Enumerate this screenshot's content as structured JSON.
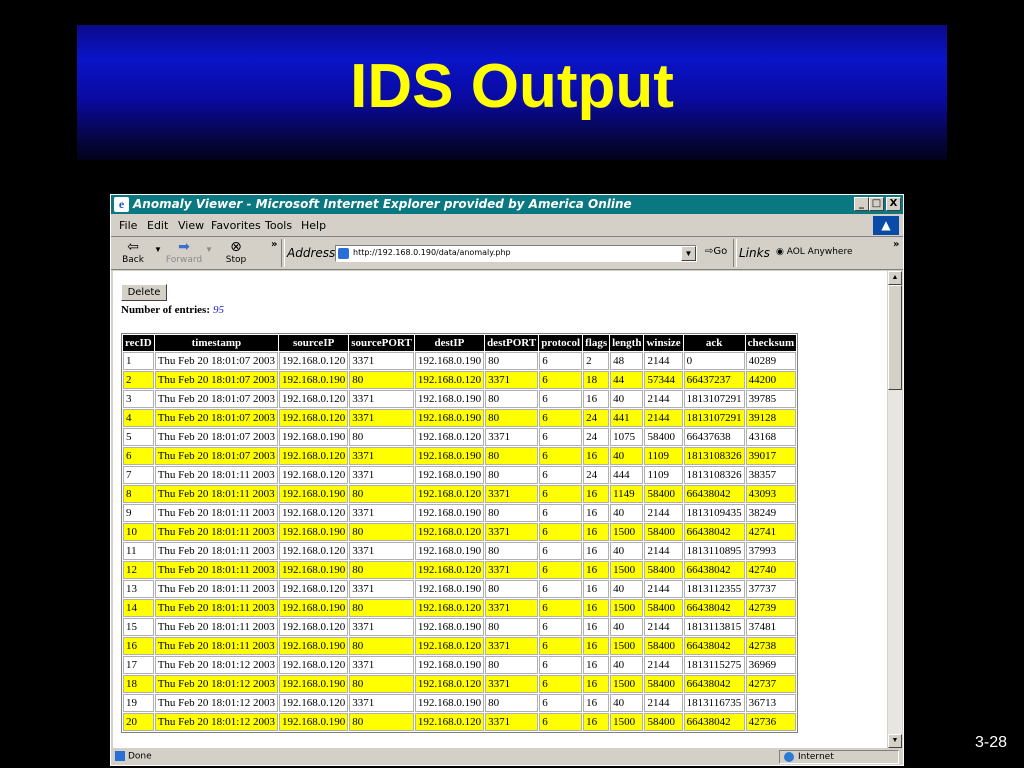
{
  "slide": {
    "title": "IDS Output",
    "number": "3-28"
  },
  "window": {
    "title": "Anomaly Viewer - Microsoft Internet Explorer provided by America Online",
    "controls": [
      "_",
      "□",
      "X"
    ]
  },
  "menu": {
    "items": [
      "File",
      "Edit",
      "View",
      "Favorites",
      "Tools",
      "Help"
    ]
  },
  "toolbar": {
    "back": "Back",
    "forward": "Forward",
    "stop": "Stop",
    "more": "»",
    "address_label": "Address",
    "url": "http://192.168.0.190/data/anomaly.php",
    "go": "Go",
    "links_label": "Links",
    "links_item": "AOL Anywhere",
    "links_more": "»"
  },
  "page": {
    "delete_label": "Delete",
    "entries_label": "Number of entries:",
    "entries_count": "95"
  },
  "table": {
    "headers": [
      "recID",
      "timestamp",
      "sourceIP",
      "sourcePORT",
      "destIP",
      "destPORT",
      "protocol",
      "flags",
      "length",
      "winsize",
      "ack",
      "checksum"
    ],
    "rows": [
      [
        "1",
        "Thu Feb 20 18:01:07 2003",
        "192.168.0.120",
        "3371",
        "192.168.0.190",
        "80",
        "6",
        "2",
        "48",
        "2144",
        "0",
        "40289"
      ],
      [
        "2",
        "Thu Feb 20 18:01:07 2003",
        "192.168.0.190",
        "80",
        "192.168.0.120",
        "3371",
        "6",
        "18",
        "44",
        "57344",
        "66437237",
        "44200"
      ],
      [
        "3",
        "Thu Feb 20 18:01:07 2003",
        "192.168.0.120",
        "3371",
        "192.168.0.190",
        "80",
        "6",
        "16",
        "40",
        "2144",
        "1813107291",
        "39785"
      ],
      [
        "4",
        "Thu Feb 20 18:01:07 2003",
        "192.168.0.120",
        "3371",
        "192.168.0.190",
        "80",
        "6",
        "24",
        "441",
        "2144",
        "1813107291",
        "39128"
      ],
      [
        "5",
        "Thu Feb 20 18:01:07 2003",
        "192.168.0.190",
        "80",
        "192.168.0.120",
        "3371",
        "6",
        "24",
        "1075",
        "58400",
        "66437638",
        "43168"
      ],
      [
        "6",
        "Thu Feb 20 18:01:07 2003",
        "192.168.0.120",
        "3371",
        "192.168.0.190",
        "80",
        "6",
        "16",
        "40",
        "1109",
        "1813108326",
        "39017"
      ],
      [
        "7",
        "Thu Feb 20 18:01:11 2003",
        "192.168.0.120",
        "3371",
        "192.168.0.190",
        "80",
        "6",
        "24",
        "444",
        "1109",
        "1813108326",
        "38357"
      ],
      [
        "8",
        "Thu Feb 20 18:01:11 2003",
        "192.168.0.190",
        "80",
        "192.168.0.120",
        "3371",
        "6",
        "16",
        "1149",
        "58400",
        "66438042",
        "43093"
      ],
      [
        "9",
        "Thu Feb 20 18:01:11 2003",
        "192.168.0.120",
        "3371",
        "192.168.0.190",
        "80",
        "6",
        "16",
        "40",
        "2144",
        "1813109435",
        "38249"
      ],
      [
        "10",
        "Thu Feb 20 18:01:11 2003",
        "192.168.0.190",
        "80",
        "192.168.0.120",
        "3371",
        "6",
        "16",
        "1500",
        "58400",
        "66438042",
        "42741"
      ],
      [
        "11",
        "Thu Feb 20 18:01:11 2003",
        "192.168.0.120",
        "3371",
        "192.168.0.190",
        "80",
        "6",
        "16",
        "40",
        "2144",
        "1813110895",
        "37993"
      ],
      [
        "12",
        "Thu Feb 20 18:01:11 2003",
        "192.168.0.190",
        "80",
        "192.168.0.120",
        "3371",
        "6",
        "16",
        "1500",
        "58400",
        "66438042",
        "42740"
      ],
      [
        "13",
        "Thu Feb 20 18:01:11 2003",
        "192.168.0.120",
        "3371",
        "192.168.0.190",
        "80",
        "6",
        "16",
        "40",
        "2144",
        "1813112355",
        "37737"
      ],
      [
        "14",
        "Thu Feb 20 18:01:11 2003",
        "192.168.0.190",
        "80",
        "192.168.0.120",
        "3371",
        "6",
        "16",
        "1500",
        "58400",
        "66438042",
        "42739"
      ],
      [
        "15",
        "Thu Feb 20 18:01:11 2003",
        "192.168.0.120",
        "3371",
        "192.168.0.190",
        "80",
        "6",
        "16",
        "40",
        "2144",
        "1813113815",
        "37481"
      ],
      [
        "16",
        "Thu Feb 20 18:01:11 2003",
        "192.168.0.190",
        "80",
        "192.168.0.120",
        "3371",
        "6",
        "16",
        "1500",
        "58400",
        "66438042",
        "42738"
      ],
      [
        "17",
        "Thu Feb 20 18:01:12 2003",
        "192.168.0.120",
        "3371",
        "192.168.0.190",
        "80",
        "6",
        "16",
        "40",
        "2144",
        "1813115275",
        "36969"
      ],
      [
        "18",
        "Thu Feb 20 18:01:12 2003",
        "192.168.0.190",
        "80",
        "192.168.0.120",
        "3371",
        "6",
        "16",
        "1500",
        "58400",
        "66438042",
        "42737"
      ],
      [
        "19",
        "Thu Feb 20 18:01:12 2003",
        "192.168.0.120",
        "3371",
        "192.168.0.190",
        "80",
        "6",
        "16",
        "40",
        "2144",
        "1813116735",
        "36713"
      ],
      [
        "20",
        "Thu Feb 20 18:01:12 2003",
        "192.168.0.190",
        "80",
        "192.168.0.120",
        "3371",
        "6",
        "16",
        "1500",
        "58400",
        "66438042",
        "42736"
      ]
    ],
    "highlight_color": "#ffff00"
  },
  "status": {
    "left": "Done",
    "zone": "Internet"
  },
  "colors": {
    "titlebar": "#0a7880",
    "slide_title": "#ffff00",
    "banner": "#0a14c8"
  }
}
